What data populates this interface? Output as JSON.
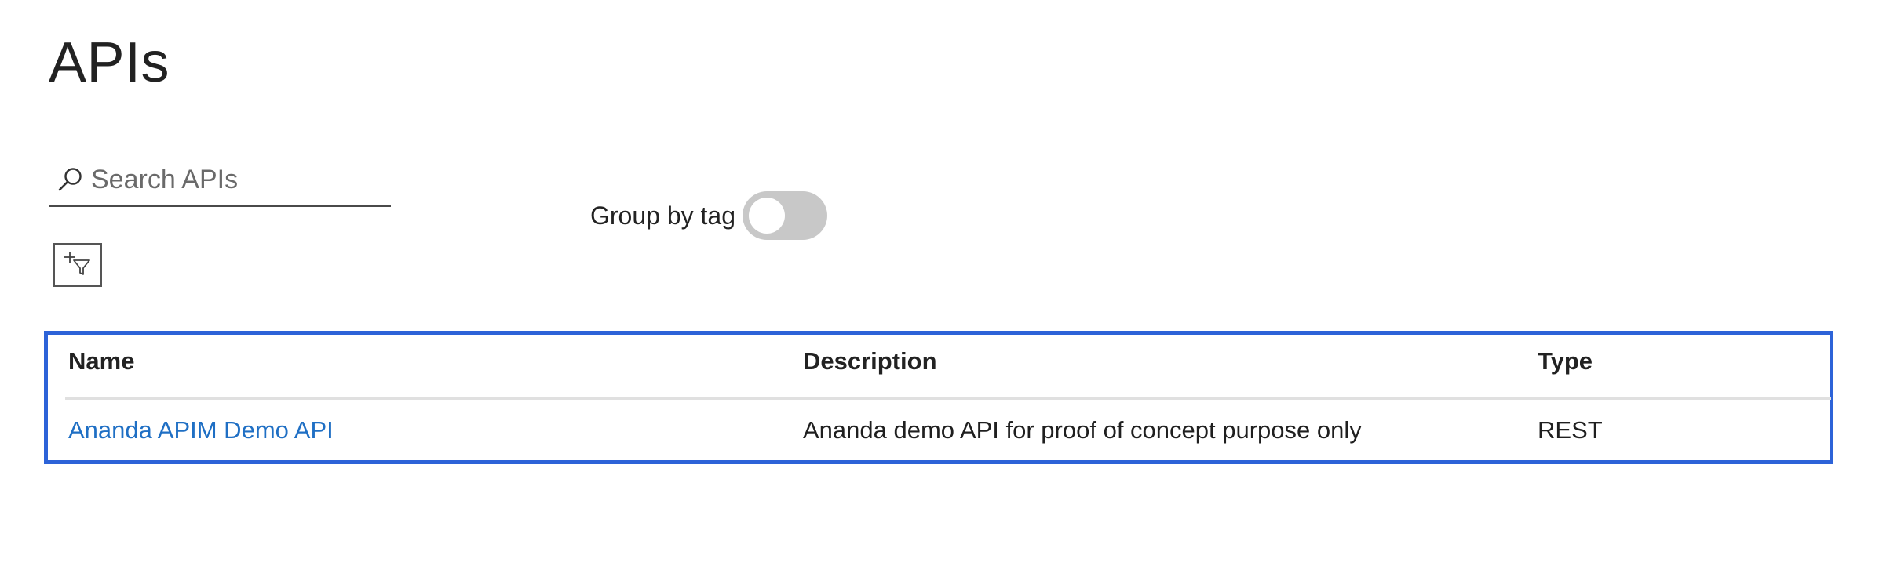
{
  "page": {
    "title": "APIs"
  },
  "search": {
    "placeholder": "Search APIs",
    "value": "",
    "icon": "search-icon"
  },
  "filter": {
    "icon": "add-filter-icon"
  },
  "group_by_tag": {
    "label": "Group by tag",
    "enabled": false
  },
  "table": {
    "columns": [
      "Name",
      "Description",
      "Type"
    ],
    "rows": [
      {
        "name": "Ananda APIM Demo API",
        "description": "Ananda demo API for proof of concept purpose only",
        "type": "REST"
      }
    ]
  },
  "colors": {
    "accent": "#2d63d8",
    "link": "#1f6fc4",
    "toggle_off": "#c8c8c8"
  }
}
